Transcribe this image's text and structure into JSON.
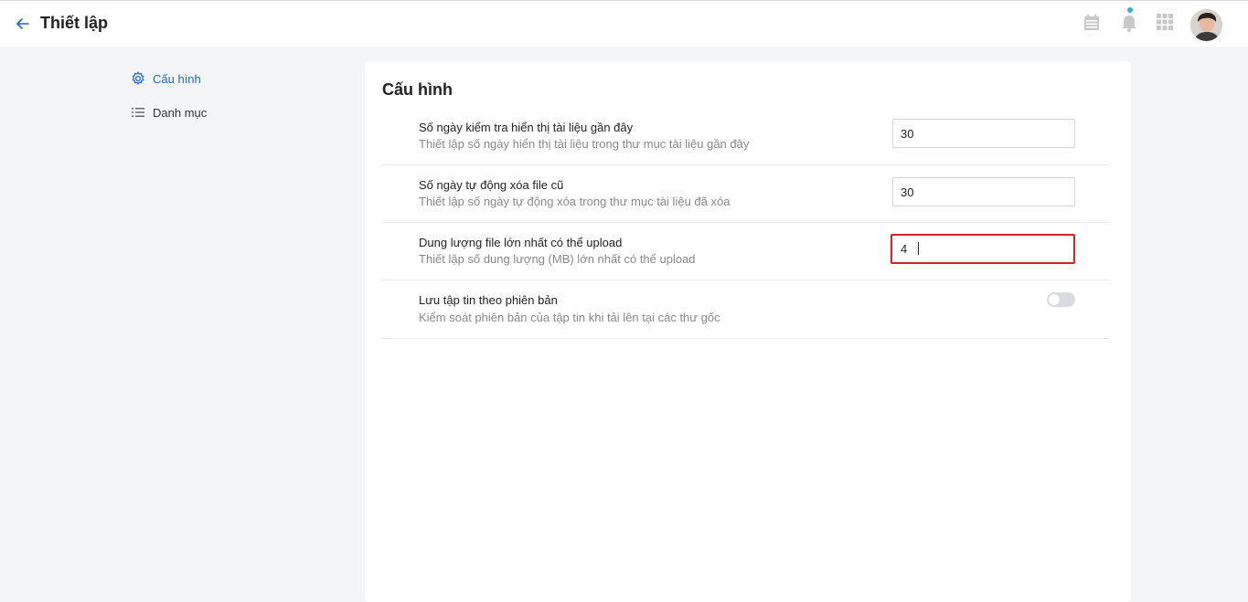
{
  "header": {
    "title": "Thiết lập",
    "icons": [
      "back-arrow-icon",
      "calendar-icon",
      "bell-icon",
      "apps-grid-icon",
      "user-avatar"
    ]
  },
  "sidebar": {
    "items": [
      {
        "label": "Cấu hình",
        "icon": "gear-icon",
        "active": true
      },
      {
        "label": "Danh mục",
        "icon": "list-icon",
        "active": false
      }
    ]
  },
  "main": {
    "title": "Cấu hình",
    "settings": [
      {
        "title": "Số ngày kiểm tra hiển thị tài liệu gần đây",
        "description": "Thiết lập số ngày hiển thị tài liệu trong thư mục tài liệu gần đây",
        "value": "30"
      },
      {
        "title": "Số ngày tự động xóa file cũ",
        "description": "Thiết lập số ngày tự động xóa trong thư mục tài liệu đã xóa",
        "value": "30"
      },
      {
        "title": "Dung lượng file lớn nhất có thể upload",
        "description": "Thiết lập số dung lượng (MB) lớn nhất có thể upload",
        "value": "4"
      },
      {
        "title": "Lưu tập tin theo phiên bản",
        "description": "Kiểm soát phiên bản của tập tin khi tải lên tại các thư gốc",
        "toggle_on": false
      }
    ]
  },
  "colors": {
    "accent": "#1e67c8",
    "focus_border": "#d8222a",
    "notification_dot": "#29b6c9"
  }
}
